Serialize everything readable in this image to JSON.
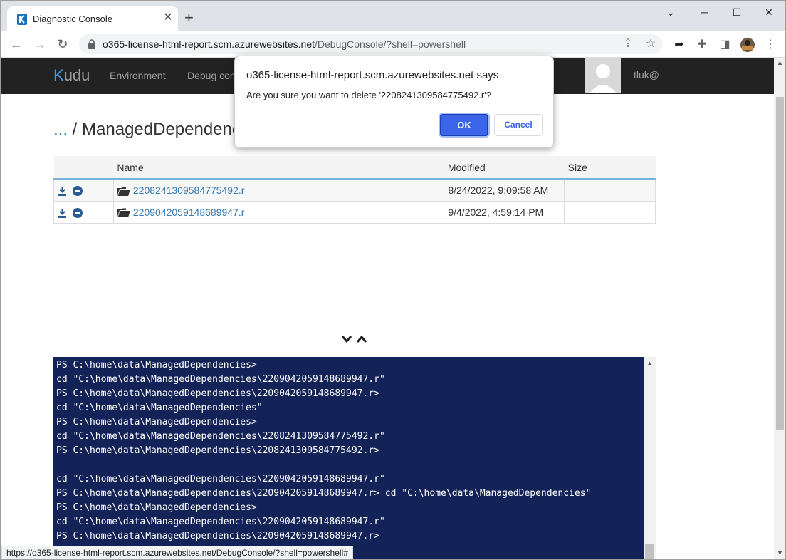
{
  "browser": {
    "tab_title": "Diagnostic Console",
    "tab_close": "✕",
    "new_tab": "+",
    "window_controls": {
      "minimize": "─",
      "maximize": "☐",
      "close": "✕",
      "tabsearch": "⌄"
    },
    "url_host": "o365-license-html-report.scm.azurewebsites.net",
    "url_path": "/DebugConsole/?shell=powershell"
  },
  "kudu": {
    "logo": "udu",
    "logo_k": "K",
    "nav": [
      "Environment",
      "Debug con"
    ],
    "user": "tluk@"
  },
  "breadcrumb": {
    "dots": "...",
    "sep": " / ",
    "current": "ManagedDependenc"
  },
  "file_table": {
    "headers": {
      "name": "Name",
      "modified": "Modified",
      "size": "Size"
    },
    "rows": [
      {
        "name": "2208241309584775492.r",
        "modified": "8/24/2022, 9:09:58 AM",
        "size": ""
      },
      {
        "name": "2209042059148689947.r",
        "modified": "9/4/2022, 4:59:14 PM",
        "size": ""
      }
    ]
  },
  "resizer": "⌄⌃",
  "console": {
    "lines": [
      "PS C:\\home\\data\\ManagedDependencies>",
      "cd \"C:\\home\\data\\ManagedDependencies\\2209042059148689947.r\"",
      "PS C:\\home\\data\\ManagedDependencies\\2209042059148689947.r>",
      "cd \"C:\\home\\data\\ManagedDependencies\"",
      "PS C:\\home\\data\\ManagedDependencies>",
      "cd \"C:\\home\\data\\ManagedDependencies\\2208241309584775492.r\"",
      "PS C:\\home\\data\\ManagedDependencies\\2208241309584775492.r>",
      "",
      "cd \"C:\\home\\data\\ManagedDependencies\\2209042059148689947.r\"",
      "PS C:\\home\\data\\ManagedDependencies\\2209042059148689947.r> cd \"C:\\home\\data\\ManagedDependencies\"",
      "PS C:\\home\\data\\ManagedDependencies>",
      "cd \"C:\\home\\data\\ManagedDependencies\\2209042059148689947.r\"",
      "PS C:\\home\\data\\ManagedDependencies\\2209042059148689947.r>"
    ]
  },
  "status_url": "https://o365-license-html-report.scm.azurewebsites.net/DebugConsole/?shell=powershell#",
  "dialog": {
    "title": "o365-license-html-report.scm.azurewebsites.net says",
    "message": "Are you sure you want to delete '2208241309584775492.r'?",
    "ok": "OK",
    "cancel": "Cancel"
  }
}
